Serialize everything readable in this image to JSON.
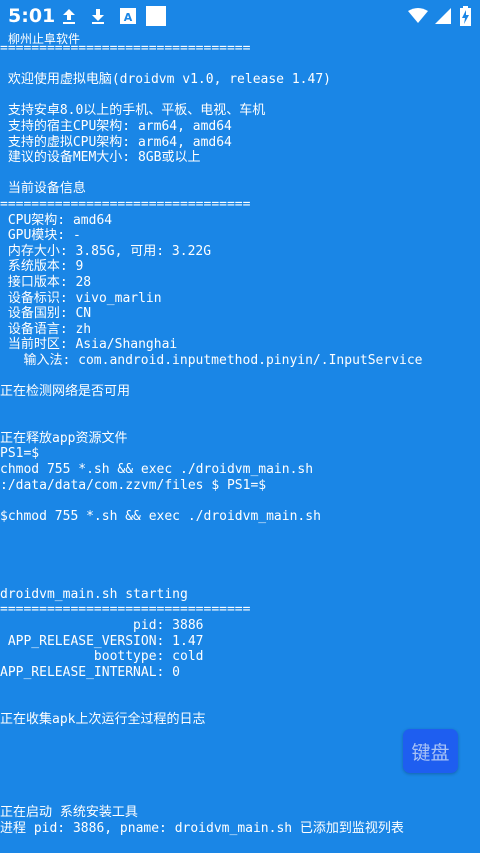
{
  "status_bar": {
    "time": "5:01",
    "icons": [
      "upload-icon",
      "download-icon",
      "text-a-icon",
      "blank-square-icon",
      "wifi-icon",
      "signal-icon",
      "battery-charging-icon"
    ]
  },
  "app_title": "柳州止阜软件",
  "console_lines": [
    "================================",
    "",
    " 欢迎使用虚拟电脑(droidvm v1.0, release 1.47)",
    "",
    " 支持安卓8.0以上的手机、平板、电视、车机",
    " 支持的宿主CPU架构: arm64, amd64",
    " 支持的虚拟CPU架构: arm64, amd64",
    " 建议的设备MEM大小: 8GB或以上",
    "",
    " 当前设备信息",
    "================================",
    " CPU架构: amd64",
    " GPU模块: -",
    " 内存大小: 3.85G, 可用: 3.22G",
    " 系统版本: 9",
    " 接口版本: 28",
    " 设备标识: vivo_marlin",
    " 设备国别: CN",
    " 设备语言: zh",
    " 当前时区: Asia/Shanghai",
    "   输入法: com.android.inputmethod.pinyin/.InputService",
    "",
    "正在检测网络是否可用",
    "",
    "",
    "正在释放app资源文件",
    "PS1=$",
    "chmod 755 *.sh && exec ./droidvm_main.sh",
    ":/data/data/com.zzvm/files $ PS1=$",
    "",
    "$chmod 755 *.sh && exec ./droidvm_main.sh",
    "",
    "",
    "",
    "",
    "droidvm_main.sh starting",
    "================================",
    "                 pid: 3886",
    " APP_RELEASE_VERSION: 1.47",
    "            boottype: cold",
    "APP_RELEASE_INTERNAL: 0",
    "",
    "",
    "正在收集apk上次运行全过程的日志",
    "",
    "",
    "",
    "",
    "",
    "正在启动 系统安装工具",
    "进程 pid: 3886, pname: droidvm_main.sh 已添加到监视列表"
  ],
  "keyboard_button": "键盘"
}
